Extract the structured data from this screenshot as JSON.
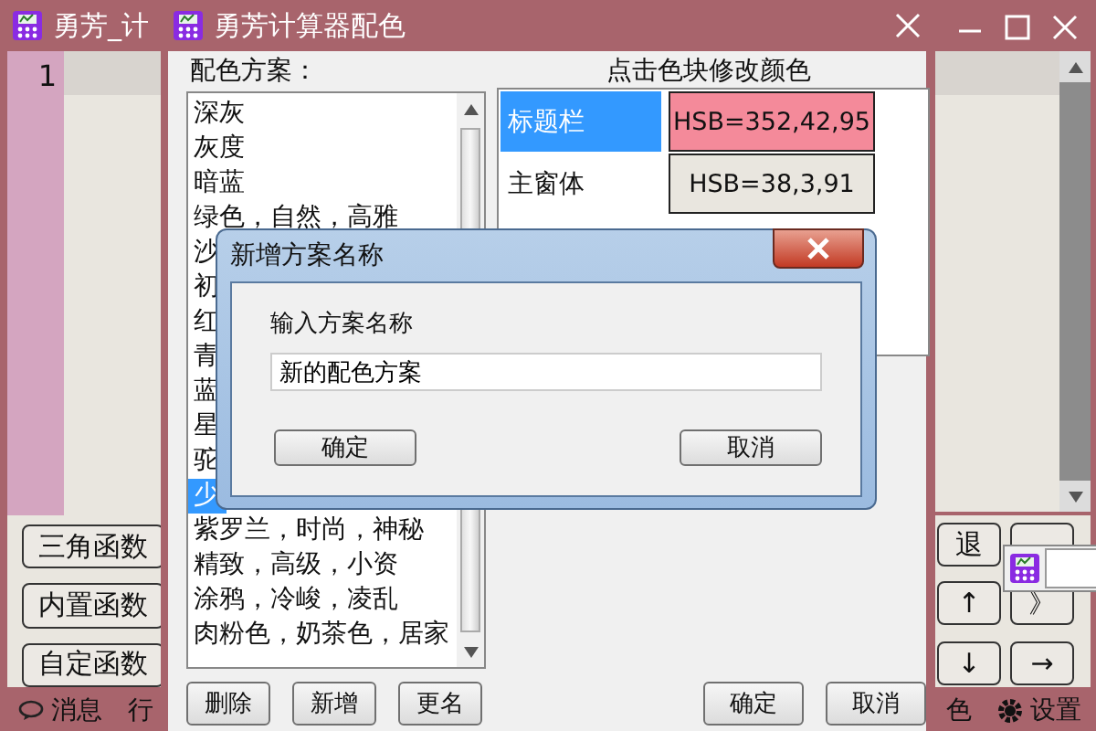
{
  "main_window": {
    "title": "勇芳_计",
    "line_number": "1",
    "function_buttons": [
      "三角函数",
      "内置函数",
      "自定函数"
    ],
    "key_buttons": [
      {
        "kind": "key",
        "label": "退"
      },
      {
        "kind": "covered"
      },
      {
        "kind": "key",
        "label": "↑"
      },
      {
        "kind": "key",
        "label": "》"
      },
      {
        "kind": "key",
        "label": "↓"
      },
      {
        "kind": "key",
        "label": "→"
      }
    ],
    "status_left": [
      {
        "kind": "message",
        "label": "消息"
      },
      {
        "kind": "plain",
        "label": "行"
      }
    ],
    "status_right": [
      {
        "kind": "plain",
        "label": "色"
      },
      {
        "kind": "settings",
        "label": "设置"
      }
    ]
  },
  "color_dialog": {
    "title": "勇芳计算器配色",
    "schemes_label": "配色方案：",
    "schemes": [
      {
        "label": "深灰",
        "selected": false
      },
      {
        "label": "灰度",
        "selected": false
      },
      {
        "label": "暗蓝",
        "selected": false
      },
      {
        "label": "绿色，自然，高雅",
        "selected": false
      },
      {
        "label": "沙",
        "selected": false
      },
      {
        "label": "初",
        "selected": false
      },
      {
        "label": "红",
        "selected": false
      },
      {
        "label": "青",
        "selected": false
      },
      {
        "label": "蓝",
        "selected": false
      },
      {
        "label": "星",
        "selected": false
      },
      {
        "label": "驼",
        "selected": false
      },
      {
        "label": "少",
        "selected": true
      },
      {
        "label": "紫罗兰，时尚，神秘",
        "selected": false
      },
      {
        "label": "精致，高级，小资",
        "selected": false
      },
      {
        "label": "涂鸦，冷峻，凌乱",
        "selected": false
      },
      {
        "label": "肉粉色，奶茶色，居家",
        "selected": false
      }
    ],
    "editor_heading": "点击色块修改颜色",
    "elements": [
      {
        "label": "标题栏",
        "selected": true,
        "swatch": "HSB=352,42,95",
        "color": "#f48a9a"
      },
      {
        "label": "主窗体",
        "selected": false,
        "swatch": "HSB=38,3,91",
        "color": "#e9e6df"
      }
    ],
    "left_buttons": [
      "删除",
      "新增",
      "更名"
    ],
    "right_buttons": [
      "确定",
      "取消"
    ]
  },
  "name_dialog": {
    "title": "新增方案名称",
    "prompt": "输入方案名称",
    "value": "新的配色方案",
    "buttons": [
      "确定",
      "取消"
    ]
  }
}
